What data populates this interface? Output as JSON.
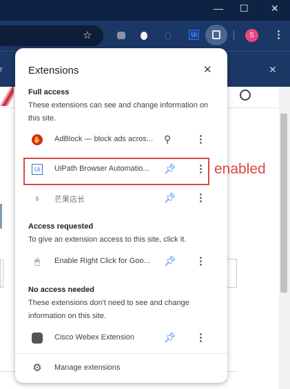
{
  "window": {
    "minimize": "—",
    "maximize": "☐",
    "close": "✕"
  },
  "toolbar": {
    "star": "☆",
    "profile_initial": "S",
    "menu": "⋮"
  },
  "infobar": {
    "text": "r",
    "close": "✕"
  },
  "panel": {
    "title": "Extensions",
    "close": "✕",
    "sections": [
      {
        "heading": "Full access",
        "description": "These extensions can see and change information on this site."
      },
      {
        "heading": "Access requested",
        "description": "To give an extension access to this site, click it."
      },
      {
        "heading": "No access needed",
        "description": "These extensions don't need to see and change information on this site."
      }
    ],
    "extensions": [
      {
        "name": "AdBlock — block ads acros...",
        "pinned": false
      },
      {
        "name": "UiPath Browser Automatio...",
        "pinned": true
      },
      {
        "name": "芒果店长",
        "pinned": true
      },
      {
        "name": "Enable Right Click for Goo...",
        "pinned": true
      },
      {
        "name": "Cisco Webex Extension",
        "pinned": true
      }
    ],
    "manage": "Manage extensions"
  },
  "annotation": {
    "label": "enabled",
    "color": "#d9473f"
  }
}
